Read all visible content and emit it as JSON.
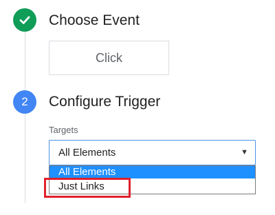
{
  "steps": [
    {
      "title": "Choose Event",
      "status": "done",
      "icon": "checkmark-icon"
    },
    {
      "number": "2",
      "title": "Configure Trigger",
      "status": "active"
    }
  ],
  "event": {
    "value": "Click"
  },
  "targets": {
    "label": "Targets",
    "selected": "All Elements",
    "arrow": "▼",
    "options": [
      "All Elements",
      "Just Links"
    ]
  },
  "colors": {
    "done_green": "#0f9d58",
    "step_blue": "#4285f4",
    "select_highlight": "#1e90ff",
    "annotation_red": "#e0202d"
  }
}
